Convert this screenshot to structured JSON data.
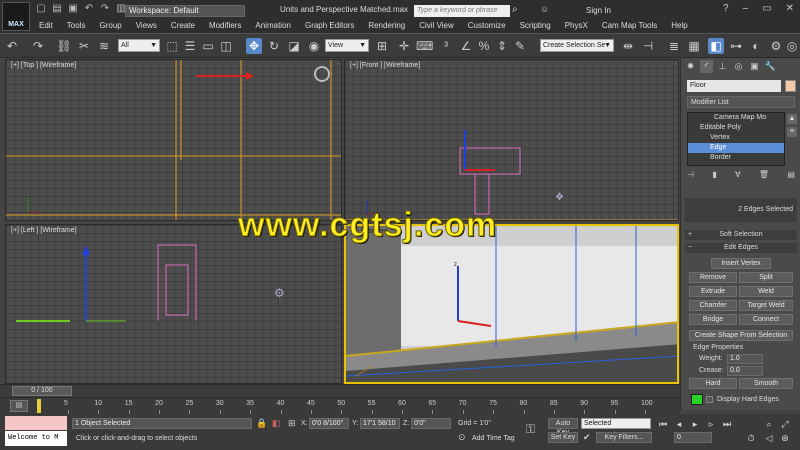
{
  "app": {
    "logo": "MAX",
    "workspace": "Workspace: Default",
    "file_title": "Units and Perspective Matched.max",
    "search_placeholder": "Type a keyword or phrase",
    "sign_in": "Sign In",
    "menu": [
      "Edit",
      "Tools",
      "Group",
      "Views",
      "Create",
      "Modifiers",
      "Animation",
      "Graph Editors",
      "Rendering",
      "Civil View",
      "Customize",
      "Scripting",
      "PhysX",
      "Cam Map Tools",
      "Help"
    ]
  },
  "toolbar": {
    "selection_filter": "All",
    "ref_coord": "View",
    "named_selection": "Create Selection Se"
  },
  "viewports": {
    "top": "[+] [Top ] [Wireframe]",
    "front": "[+] [Front ] [Wireframe]",
    "left": "[+] [Left ] [Wireframe]",
    "persp": "[+] [Camera"
  },
  "watermark": "www.cgtsj.com",
  "command_panel": {
    "object_name": "Floor",
    "object_color": "#f3c9a8",
    "modifier_list": "Modifier List",
    "stack": [
      "Camera Map Mo",
      "Editable Poly",
      "Vertex",
      "Edge",
      "Border"
    ],
    "selection_info": "2 Edges Selected",
    "soft_selection": "Soft Selection",
    "edit_edges": "Edit Edges",
    "buttons": {
      "insert_vertex": "Insert Vertex",
      "remove": "Remove",
      "split": "Split",
      "extrude": "Extrude",
      "weld": "Weld",
      "chamfer": "Chamfer",
      "target_weld": "Target Weld",
      "bridge": "Bridge",
      "connect": "Connect",
      "create_shape": "Create Shape From Selection",
      "hard": "Hard",
      "smooth": "Smooth"
    },
    "edge_properties": "Edge Properties",
    "weight_label": "Weight:",
    "weight_value": "1.0",
    "crease_label": "Crease:",
    "crease_value": "0.0",
    "display_hard_edges": "Display Hard Edges",
    "hard_edge_color": "#2bd12b"
  },
  "timeline": {
    "slider": "0 / 100",
    "ticks": [
      "5",
      "10",
      "15",
      "20",
      "25",
      "30",
      "35",
      "40",
      "45",
      "50",
      "55",
      "60",
      "65",
      "70",
      "75",
      "80",
      "85",
      "90",
      "95",
      "100"
    ]
  },
  "status": {
    "maxscript": "Welcome to M",
    "objects_selected": "1 Object Selected",
    "prompt": "Click or click-and-drag to select objects",
    "x_label": "X:",
    "x_value": "0'0 8/100\"",
    "y_label": "Y:",
    "y_value": "17'1 58/10",
    "z_label": "Z:",
    "z_value": "0'0\"",
    "grid": "Grid = 1'0\"",
    "add_time_tag": "Add Time Tag",
    "auto_key": "Auto Key",
    "key_mode": "Selected",
    "set_key": "Set Key",
    "key_filters": "Key Filters...",
    "frame": "0"
  }
}
